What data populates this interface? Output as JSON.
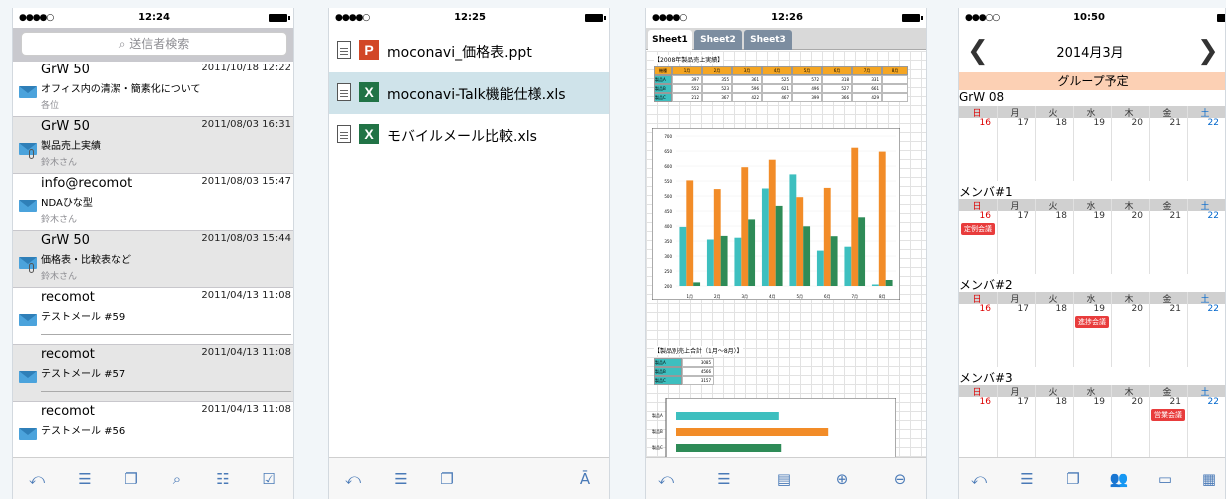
{
  "mail": {
    "status_time": "12:24",
    "search_placeholder": "送信者検索",
    "messages": [
      {
        "from": "GrW 50",
        "date": "2011/10/18 12:22",
        "subject": "オフィス内の清潔・簡素化について",
        "to": "各位",
        "gray": false,
        "attach": false,
        "preview_line": false
      },
      {
        "from": "GrW 50",
        "date": "2011/08/03 16:31",
        "subject": "製品売上実績",
        "to": "鈴木さん",
        "gray": true,
        "attach": true,
        "preview_line": false
      },
      {
        "from": "info@recomot",
        "date": "2011/08/03 15:47",
        "subject": "NDAひな型",
        "to": "鈴木さん",
        "gray": false,
        "attach": false,
        "preview_line": false
      },
      {
        "from": "GrW 50",
        "date": "2011/08/03 15:44",
        "subject": "価格表・比較表など",
        "to": "鈴木さん",
        "gray": true,
        "attach": true,
        "preview_line": false
      },
      {
        "from": "recomot",
        "date": "2011/04/13 11:08",
        "subject": "テストメール #59",
        "to": "",
        "gray": false,
        "attach": false,
        "preview_line": true
      },
      {
        "from": "recomot",
        "date": "2011/04/13 11:08",
        "subject": "テストメール #57",
        "to": "",
        "gray": true,
        "attach": false,
        "preview_line": true
      },
      {
        "from": "recomot",
        "date": "2011/04/13 11:08",
        "subject": "テストメール #56",
        "to": "",
        "gray": false,
        "attach": false,
        "preview_line": false
      }
    ],
    "toolbar_icons": [
      "back-icon",
      "list-icon",
      "window-icon",
      "search-icon",
      "checklist-icon",
      "check-icon"
    ]
  },
  "files": {
    "status_time": "12:25",
    "items": [
      {
        "name": "moconavi_価格表.ppt",
        "badge": "P",
        "badge_color": "#d24726",
        "selected": false
      },
      {
        "name": "moconavi-Talk機能仕様.xls",
        "badge": "X",
        "badge_color": "#217346",
        "selected": true
      },
      {
        "name": "モバイルメール比較.xls",
        "badge": "X",
        "badge_color": "#217346",
        "selected": false
      }
    ],
    "toolbar_icons": [
      "back-icon",
      "list-icon",
      "window-icon",
      "text-size-icon"
    ]
  },
  "sheet": {
    "status_time": "12:26",
    "tabs": [
      "Sheet1",
      "Sheet2",
      "Sheet3"
    ],
    "active_tab": 0,
    "table_title": "【2008年製品売上実績】",
    "table_headers": [
      "機種",
      "1月",
      "2月",
      "3月",
      "4月",
      "5月",
      "6月",
      "7月",
      "8月"
    ],
    "table_rows": [
      {
        "label": "製品A",
        "values": [
          "397",
          "355",
          "361",
          "525",
          "572",
          "318",
          "331",
          ""
        ]
      },
      {
        "label": "製品B",
        "values": [
          "552",
          "523",
          "596",
          "621",
          "496",
          "527",
          "661",
          ""
        ]
      },
      {
        "label": "製品C",
        "values": [
          "212",
          "367",
          "422",
          "467",
          "399",
          "366",
          "429",
          ""
        ]
      }
    ],
    "sum_title": "【製品別売上合計（1月〜8月）】",
    "sum_rows": [
      {
        "label": "製品A",
        "value": "3085"
      },
      {
        "label": "製品B",
        "value": "4566"
      },
      {
        "label": "製品C",
        "value": "3157"
      }
    ],
    "toolbar_icons": [
      "back-icon",
      "list-icon",
      "document-icon",
      "zoom-in-icon",
      "zoom-out-icon"
    ]
  },
  "chart_data": [
    {
      "type": "bar",
      "title": "",
      "categories": [
        "1月",
        "2月",
        "3月",
        "4月",
        "5月",
        "6月",
        "7月",
        "8月"
      ],
      "ylim": [
        200,
        700
      ],
      "yticks": [
        "700",
        "650",
        "600",
        "550",
        "500",
        "450",
        "400",
        "350",
        "300",
        "250",
        "200"
      ],
      "series": [
        {
          "name": "",
          "color": "#3dbfbf",
          "values": [
            397,
            355,
            361,
            525,
            572,
            318,
            331,
            205
          ]
        },
        {
          "name": "",
          "color": "#f28c28",
          "values": [
            552,
            523,
            596,
            621,
            496,
            527,
            661,
            648
          ]
        },
        {
          "name": "",
          "color": "#2e8b57",
          "values": [
            212,
            367,
            422,
            467,
            399,
            366,
            429,
            220
          ]
        }
      ]
    },
    {
      "type": "bar",
      "orientation": "horizontal",
      "title": "",
      "categories": [
        "製品A",
        "製品B",
        "製品C"
      ],
      "values": [
        3085,
        4566,
        3157
      ],
      "colors": [
        "#3dbfbf",
        "#f28c28",
        "#2e8b57"
      ]
    }
  ],
  "calendar": {
    "status_time": "10:50",
    "month_title": "2014月3月",
    "group_title": "グループ予定",
    "weekdays": [
      "日",
      "月",
      "火",
      "水",
      "木",
      "金",
      "土"
    ],
    "days": [
      "16",
      "17",
      "18",
      "19",
      "20",
      "21",
      "22"
    ],
    "sections": [
      {
        "name": "GrW 08",
        "events": []
      },
      {
        "name": "メンバ#1",
        "events": [
          {
            "day": 0,
            "label": "定例会議"
          }
        ]
      },
      {
        "name": "メンバ#2",
        "events": [
          {
            "day": 3,
            "label": "進捗会議"
          }
        ]
      },
      {
        "name": "メンバ#3",
        "events": [
          {
            "day": 5,
            "label": "営業会議"
          }
        ]
      }
    ],
    "toolbar_icons": [
      "back-icon",
      "list-icon",
      "window-icon",
      "people-icon",
      "day-view-icon",
      "month-view-icon"
    ]
  }
}
